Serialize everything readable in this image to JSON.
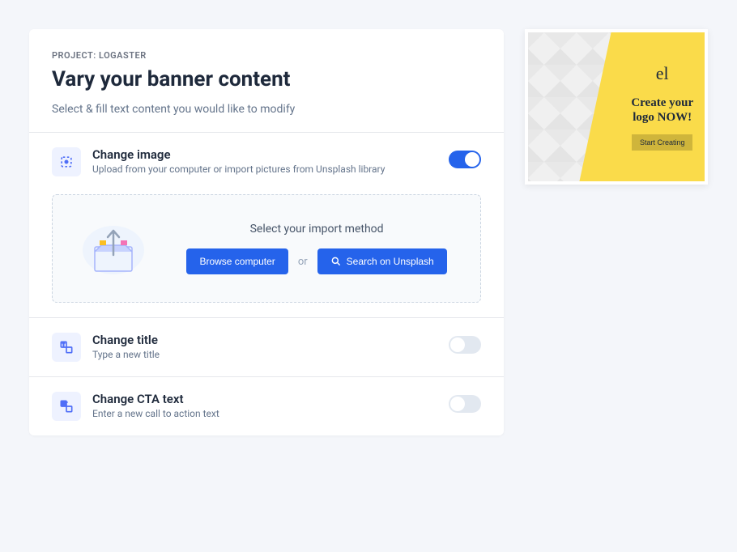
{
  "header": {
    "project": "PROJECT: LOGASTER",
    "title": "Vary your banner content",
    "subtitle": "Select & fill text content you would like to modify"
  },
  "sections": {
    "image": {
      "title": "Change image",
      "desc": "Upload from your computer or import pictures from Unsplash library",
      "toggled": true
    },
    "title": {
      "title": "Change title",
      "desc": "Type a new title",
      "toggled": false
    },
    "cta": {
      "title": "Change CTA text",
      "desc": "Enter a new call to action text",
      "toggled": false
    }
  },
  "import": {
    "label": "Select your import method",
    "browse": "Browse computer",
    "or": "or",
    "search": "Search on Unsplash"
  },
  "preview": {
    "logo": "el",
    "headline": "Create your logo NOW!",
    "cta": "Start Creating"
  }
}
